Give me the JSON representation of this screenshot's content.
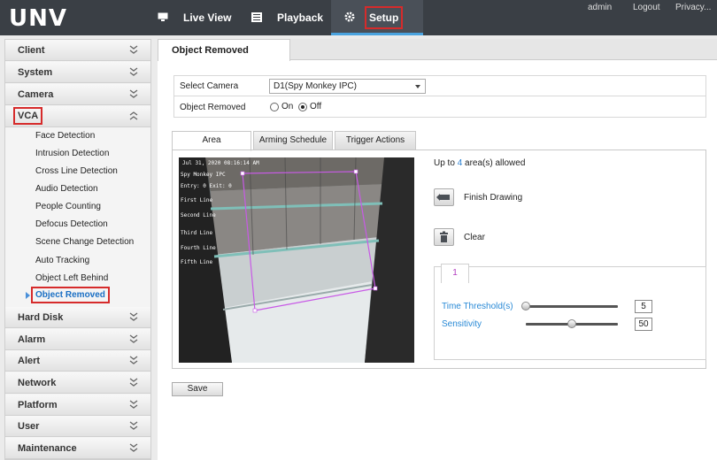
{
  "header": {
    "logo": "UNV",
    "nav": [
      "Live View",
      "Playback",
      "Setup"
    ],
    "links": [
      "admin",
      "Logout",
      "Privacy..."
    ]
  },
  "sidebar": {
    "sections": [
      "Client",
      "System",
      "Camera",
      "VCA",
      "Hard Disk",
      "Alarm",
      "Alert",
      "Network",
      "Platform",
      "User",
      "Maintenance"
    ],
    "vca_items": [
      "Face Detection",
      "Intrusion Detection",
      "Cross Line Detection",
      "Audio Detection",
      "People Counting",
      "Defocus Detection",
      "Scene Change Detection",
      "Auto Tracking",
      "Object Left Behind",
      "Object Removed"
    ]
  },
  "page": {
    "title": "Object Removed",
    "select_camera_label": "Select Camera",
    "camera_value": "D1(Spy Monkey IPC)",
    "object_removed_label": "Object Removed",
    "on_label": "On",
    "off_label": "Off",
    "object_removed_state": "Off",
    "tabs": [
      "Area",
      "Arming Schedule",
      "Trigger Actions"
    ],
    "allowed_prefix": "Up to",
    "allowed_count": "4",
    "allowed_suffix": "area(s) allowed",
    "finish_drawing": "Finish Drawing",
    "clear": "Clear",
    "area_tab": "1",
    "time_threshold_label": "Time Threshold(s)",
    "time_threshold_value": "5",
    "sensitivity_label": "Sensitivity",
    "sensitivity_value": "50",
    "save": "Save"
  },
  "video": {
    "timestamp": "Jul 31, 2020 08:16:14 AM",
    "camera_name": "Spy Monkey IPC",
    "entry_exit": "Entry:   0 Exit:  0",
    "lines": [
      "First Line",
      "Second Line",
      "Third Line",
      "Fourth Line",
      "Fifth Line"
    ]
  },
  "sliders": {
    "time_threshold_fraction": 0.0,
    "sensitivity_fraction": 0.5
  },
  "colors": {
    "topbar": "#3a3f45",
    "accent_blue": "#2a8ad6",
    "highlight_red": "#d62b2b",
    "polygon": "#c85ae6"
  }
}
